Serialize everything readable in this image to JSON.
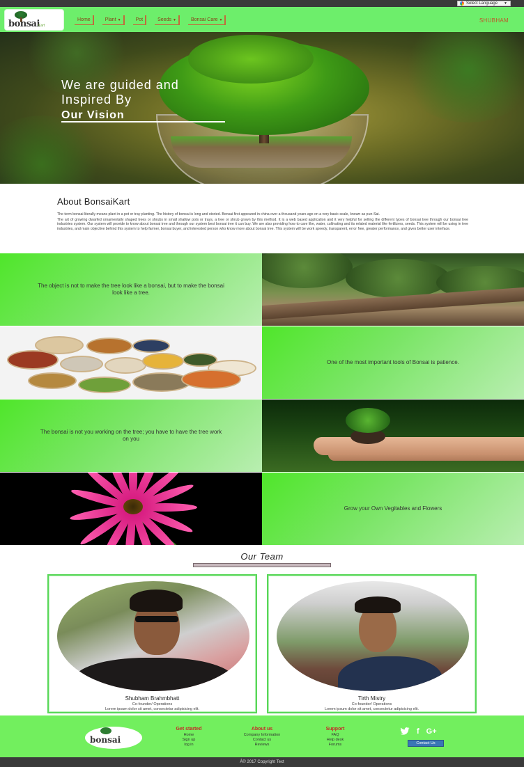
{
  "language_selector": {
    "label": "Select Language",
    "icon": "google-icon"
  },
  "brand": {
    "name": "bonsai",
    "tagline": "Kart"
  },
  "nav": {
    "items": [
      {
        "label": "Home",
        "dropdown": false
      },
      {
        "label": "Plant",
        "dropdown": true
      },
      {
        "label": "Pot",
        "dropdown": false
      },
      {
        "label": "Seeds",
        "dropdown": true
      },
      {
        "label": "Bonsai Care",
        "dropdown": true
      }
    ],
    "user": "SHUBHAM"
  },
  "hero": {
    "line1": "We are guided and",
    "line2": "Inspired By",
    "line3": "Our Vision"
  },
  "about": {
    "title": "About BonsaiKart",
    "p1": "The term bonsai literally means plant in a pot or tray planting. The history of bonsai is long and storied. Bonsai first appeared in china over a thousand years ago on a very basic scale, known as pun-Sai.",
    "p2": "The art of growing dwarfed ornamentally shaped trees or shrubs in small shallow pots or trays, a tree or shrub grown by this method. It is a web based application and it very helpful for selling the different types of bonsai tree through our bonsai tree industries system. Our system will provide to know about bonsai tree and through our system best bonsai tree it can buy. We are also providing how to care like, water, cultivating and its related material like fertilizers, seeds. This system will be using in tree industries, and main objective behind this system to help farmer, bonsai buyer, and interested person who know more about bonsai tree. This system will be work speedy, transparent, error free, greater performance, and gives better user interface."
  },
  "quotes": {
    "q1": "The object is not to make the tree look like a bonsai, but to make the bonsai look like a tree.",
    "q2": "One of the most important tools of Bonsai is patience.",
    "q3": "The bonsai is not you working on the tree; you have to have the tree work on you",
    "q4": "Grow your Own Vegitables and Flowers"
  },
  "team": {
    "title": "Our Team",
    "members": [
      {
        "name": "Shubham Brahmbhatt",
        "role": "Co-founder/ Operations",
        "desc": "Lorem ipsum dolor sit amet, consectetur adipisicing elit."
      },
      {
        "name": "Tirth Mistry",
        "role": "Co-founder/ Operations",
        "desc": "Lorem ipsum dolor sit amet, consectetur adipisicing elit."
      }
    ]
  },
  "footer": {
    "get_started": {
      "title": "Get started",
      "links": [
        "Home",
        "Sign up",
        "log in"
      ]
    },
    "about_us": {
      "title": "About us",
      "links": [
        "Company Information",
        "Contact us",
        "Reviews"
      ]
    },
    "support": {
      "title": "Support",
      "links": [
        "FAQ",
        "Help desk",
        "Forums"
      ]
    },
    "social": {
      "twitter": "twitter-icon",
      "facebook": "facebook-icon",
      "google_plus": "google-plus-icon"
    },
    "contact_button": "Contact Us",
    "copyright": "Â© 2017 Copyright Text"
  },
  "colors": {
    "nav_green": "#6dee6b",
    "footer_green": "#72ef5e",
    "accent_orange": "#c0562a",
    "footer_heading": "#c62828",
    "contact_blue": "#3a76b6"
  }
}
